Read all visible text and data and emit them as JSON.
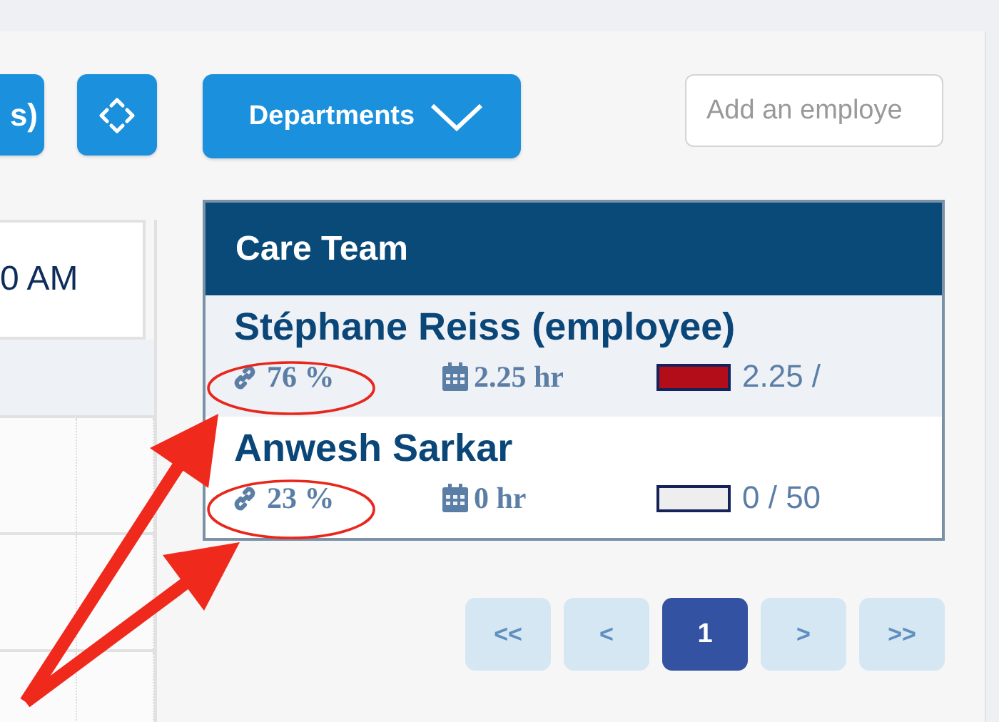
{
  "toolbar": {
    "partial_button": "s)",
    "departments_button": "Departments",
    "search": {
      "placeholder": "Add an employe"
    }
  },
  "left_panel": {
    "cell": "0 AM"
  },
  "care_team": {
    "title": "Care Team",
    "rows": [
      {
        "name": "Stéphane Reiss (employee)",
        "highlighted": true,
        "percent": "76 %",
        "hours": "2.25 hr",
        "level": 1,
        "ratio": "2.25 /"
      },
      {
        "name": "Anwesh Sarkar",
        "highlighted": false,
        "percent": "23 %",
        "hours": "0 hr",
        "level": 0,
        "ratio": "0 / 50"
      }
    ]
  },
  "pagination": [
    {
      "label": "<<",
      "selected": false
    },
    {
      "label": "<",
      "selected": false
    },
    {
      "label": "1",
      "selected": true
    },
    {
      "label": ">",
      "selected": false
    },
    {
      "label": ">>",
      "selected": false
    }
  ]
}
